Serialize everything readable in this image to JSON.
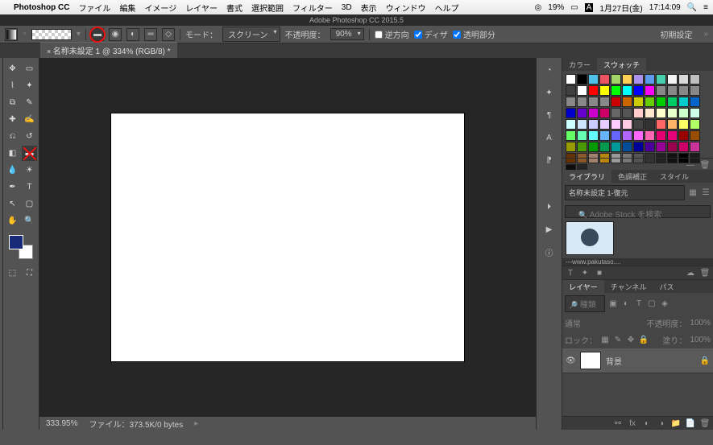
{
  "menubar": {
    "app": "Photoshop CC",
    "items": [
      "ファイル",
      "編集",
      "イメージ",
      "レイヤー",
      "書式",
      "選択範囲",
      "フィルター",
      "3D",
      "表示",
      "ウィンドウ",
      "ヘルプ"
    ],
    "right": {
      "battery": "19%",
      "date": "1月27日(金)",
      "time": "17:14:09"
    }
  },
  "title": "Adobe Photoshop CC 2015.5",
  "options": {
    "mode_label": "モード：",
    "mode_value": "スクリーン",
    "opacity_label": "不透明度：",
    "opacity_value": "90%",
    "reverse": "逆方向",
    "dither": "ディザ",
    "transparent": "透明部分",
    "preset": "初期設定"
  },
  "doc_tab": "名称未設定 1 @ 334% (RGB/8) *",
  "status": {
    "zoom": "333.95%",
    "file": "ファイル：373.5K/0 bytes"
  },
  "panels": {
    "color_tab": "カラー",
    "swatches_tab": "スウォッチ",
    "swatch_rows": [
      [
        "#ffffff",
        "#000000",
        "#4fc1e9",
        "#ed5565",
        "#a0d468",
        "#ffce54",
        "#ac92ec",
        "#5d9cec",
        "#48cfad",
        "#f3f3f3",
        "#d9d9d9",
        "#bfbfbf",
        "#404040",
        "#ffffff"
      ],
      [
        "#ff0000",
        "#ffff00",
        "#00ff00",
        "#00ffff",
        "#0000ff",
        "#ff00ff",
        "#888",
        "#888",
        "#888",
        "#888",
        "#888",
        "#888",
        "#888",
        "#888"
      ],
      [
        "#cc0000",
        "#cc6600",
        "#cccc00",
        "#66cc00",
        "#00cc00",
        "#00cc66",
        "#00cccc",
        "#0066cc",
        "#0000cc",
        "#6600cc",
        "#cc00cc",
        "#cc0066",
        "#666",
        "#555"
      ],
      [
        "#ffcccc",
        "#ffe6cc",
        "#ffffcc",
        "#e6ffcc",
        "#ccffcc",
        "#ccffe6",
        "#ccffff",
        "#cce6ff",
        "#ccccff",
        "#e6ccff",
        "#ffccff",
        "#ffcce6",
        "#444",
        "#333"
      ],
      [
        "#ff6666",
        "#ffb366",
        "#ffff66",
        "#b3ff66",
        "#66ff66",
        "#66ffb3",
        "#66ffff",
        "#66b3ff",
        "#6666ff",
        "#b366ff",
        "#ff66ff",
        "#ff66b3",
        "#e60073",
        "#e6007a"
      ],
      [
        "#990000",
        "#994d00",
        "#999900",
        "#4d9900",
        "#009900",
        "#00994d",
        "#009999",
        "#004d99",
        "#000099",
        "#4d0099",
        "#990099",
        "#99004d",
        "#cc0066",
        "#cc3399"
      ],
      [
        "#663300",
        "#8b5a2b",
        "#a0826d",
        "#b8860b",
        "#999",
        "#777",
        "#555",
        "#333",
        "#222",
        "#111",
        "#000",
        "#1a1a1a",
        "#0d0d0d",
        "#262626"
      ]
    ],
    "library_tab": "ライブラリ",
    "tone_tab": "色調補正",
    "style_tab": "スタイル",
    "library_dd": "名称未設定 1-復元",
    "search_placeholder": "Adobe Stock を検索",
    "thumb_caption": "---www.pakutaso....",
    "layers_tab": "レイヤー",
    "channels_tab": "チャンネル",
    "paths_tab": "パス",
    "blend_mode": "通常",
    "opacity_label": "不透明度：",
    "opacity_value": "100%",
    "lock_label": "ロック：",
    "fill_label": "塗り：",
    "fill_value": "100%",
    "filter_placeholder": "種類",
    "layer_name": "背景"
  }
}
